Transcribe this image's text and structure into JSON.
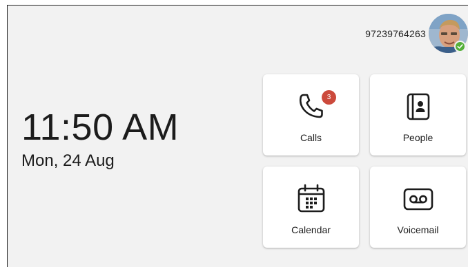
{
  "header": {
    "phone_number": "97239764263",
    "avatar_icon": "user-avatar",
    "presence_status": "available",
    "presence_color": "#55b03a"
  },
  "clock": {
    "time": "11:50 AM",
    "date": "Mon, 24 Aug"
  },
  "tiles": {
    "calls": {
      "label": "Calls",
      "icon": "phone-icon",
      "badge": "3"
    },
    "people": {
      "label": "People",
      "icon": "contacts-book-icon"
    },
    "calendar": {
      "label": "Calendar",
      "icon": "calendar-icon"
    },
    "voicemail": {
      "label": "Voicemail",
      "icon": "voicemail-icon"
    }
  },
  "colors": {
    "background": "#f2f2f2",
    "tile": "#ffffff",
    "badge": "#cc4a3c",
    "text": "#1c1c1c"
  }
}
